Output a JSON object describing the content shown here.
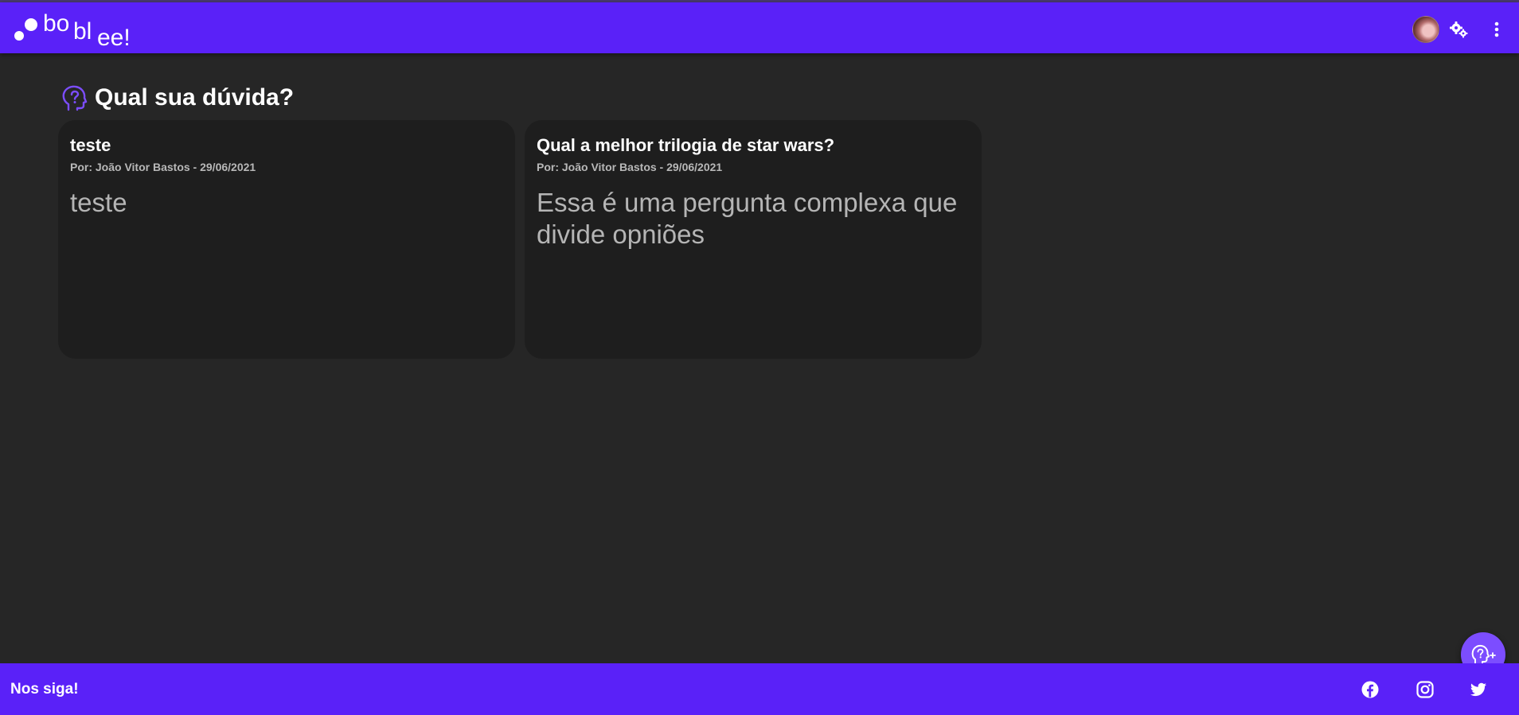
{
  "header": {
    "brand": {
      "part1": "bo",
      "part2": "bl",
      "part3": "ee!"
    },
    "bg_color": "#5a21f8"
  },
  "page": {
    "title": "Qual sua dúvida?",
    "icon": "head-question-icon",
    "accent": "#7c4dff"
  },
  "questions": [
    {
      "title": "teste",
      "meta": "Por: João Vitor Bastos - 29/06/2021",
      "body": "teste"
    },
    {
      "title": "Qual a melhor trilogia de star wars?",
      "meta": "Por: João Vitor Bastos - 29/06/2021",
      "body": "Essa é uma pergunta complexa que divide opniões"
    }
  ],
  "footer": {
    "label": "Nos siga!",
    "socials": [
      "facebook-icon",
      "instagram-icon",
      "twitter-icon"
    ]
  }
}
